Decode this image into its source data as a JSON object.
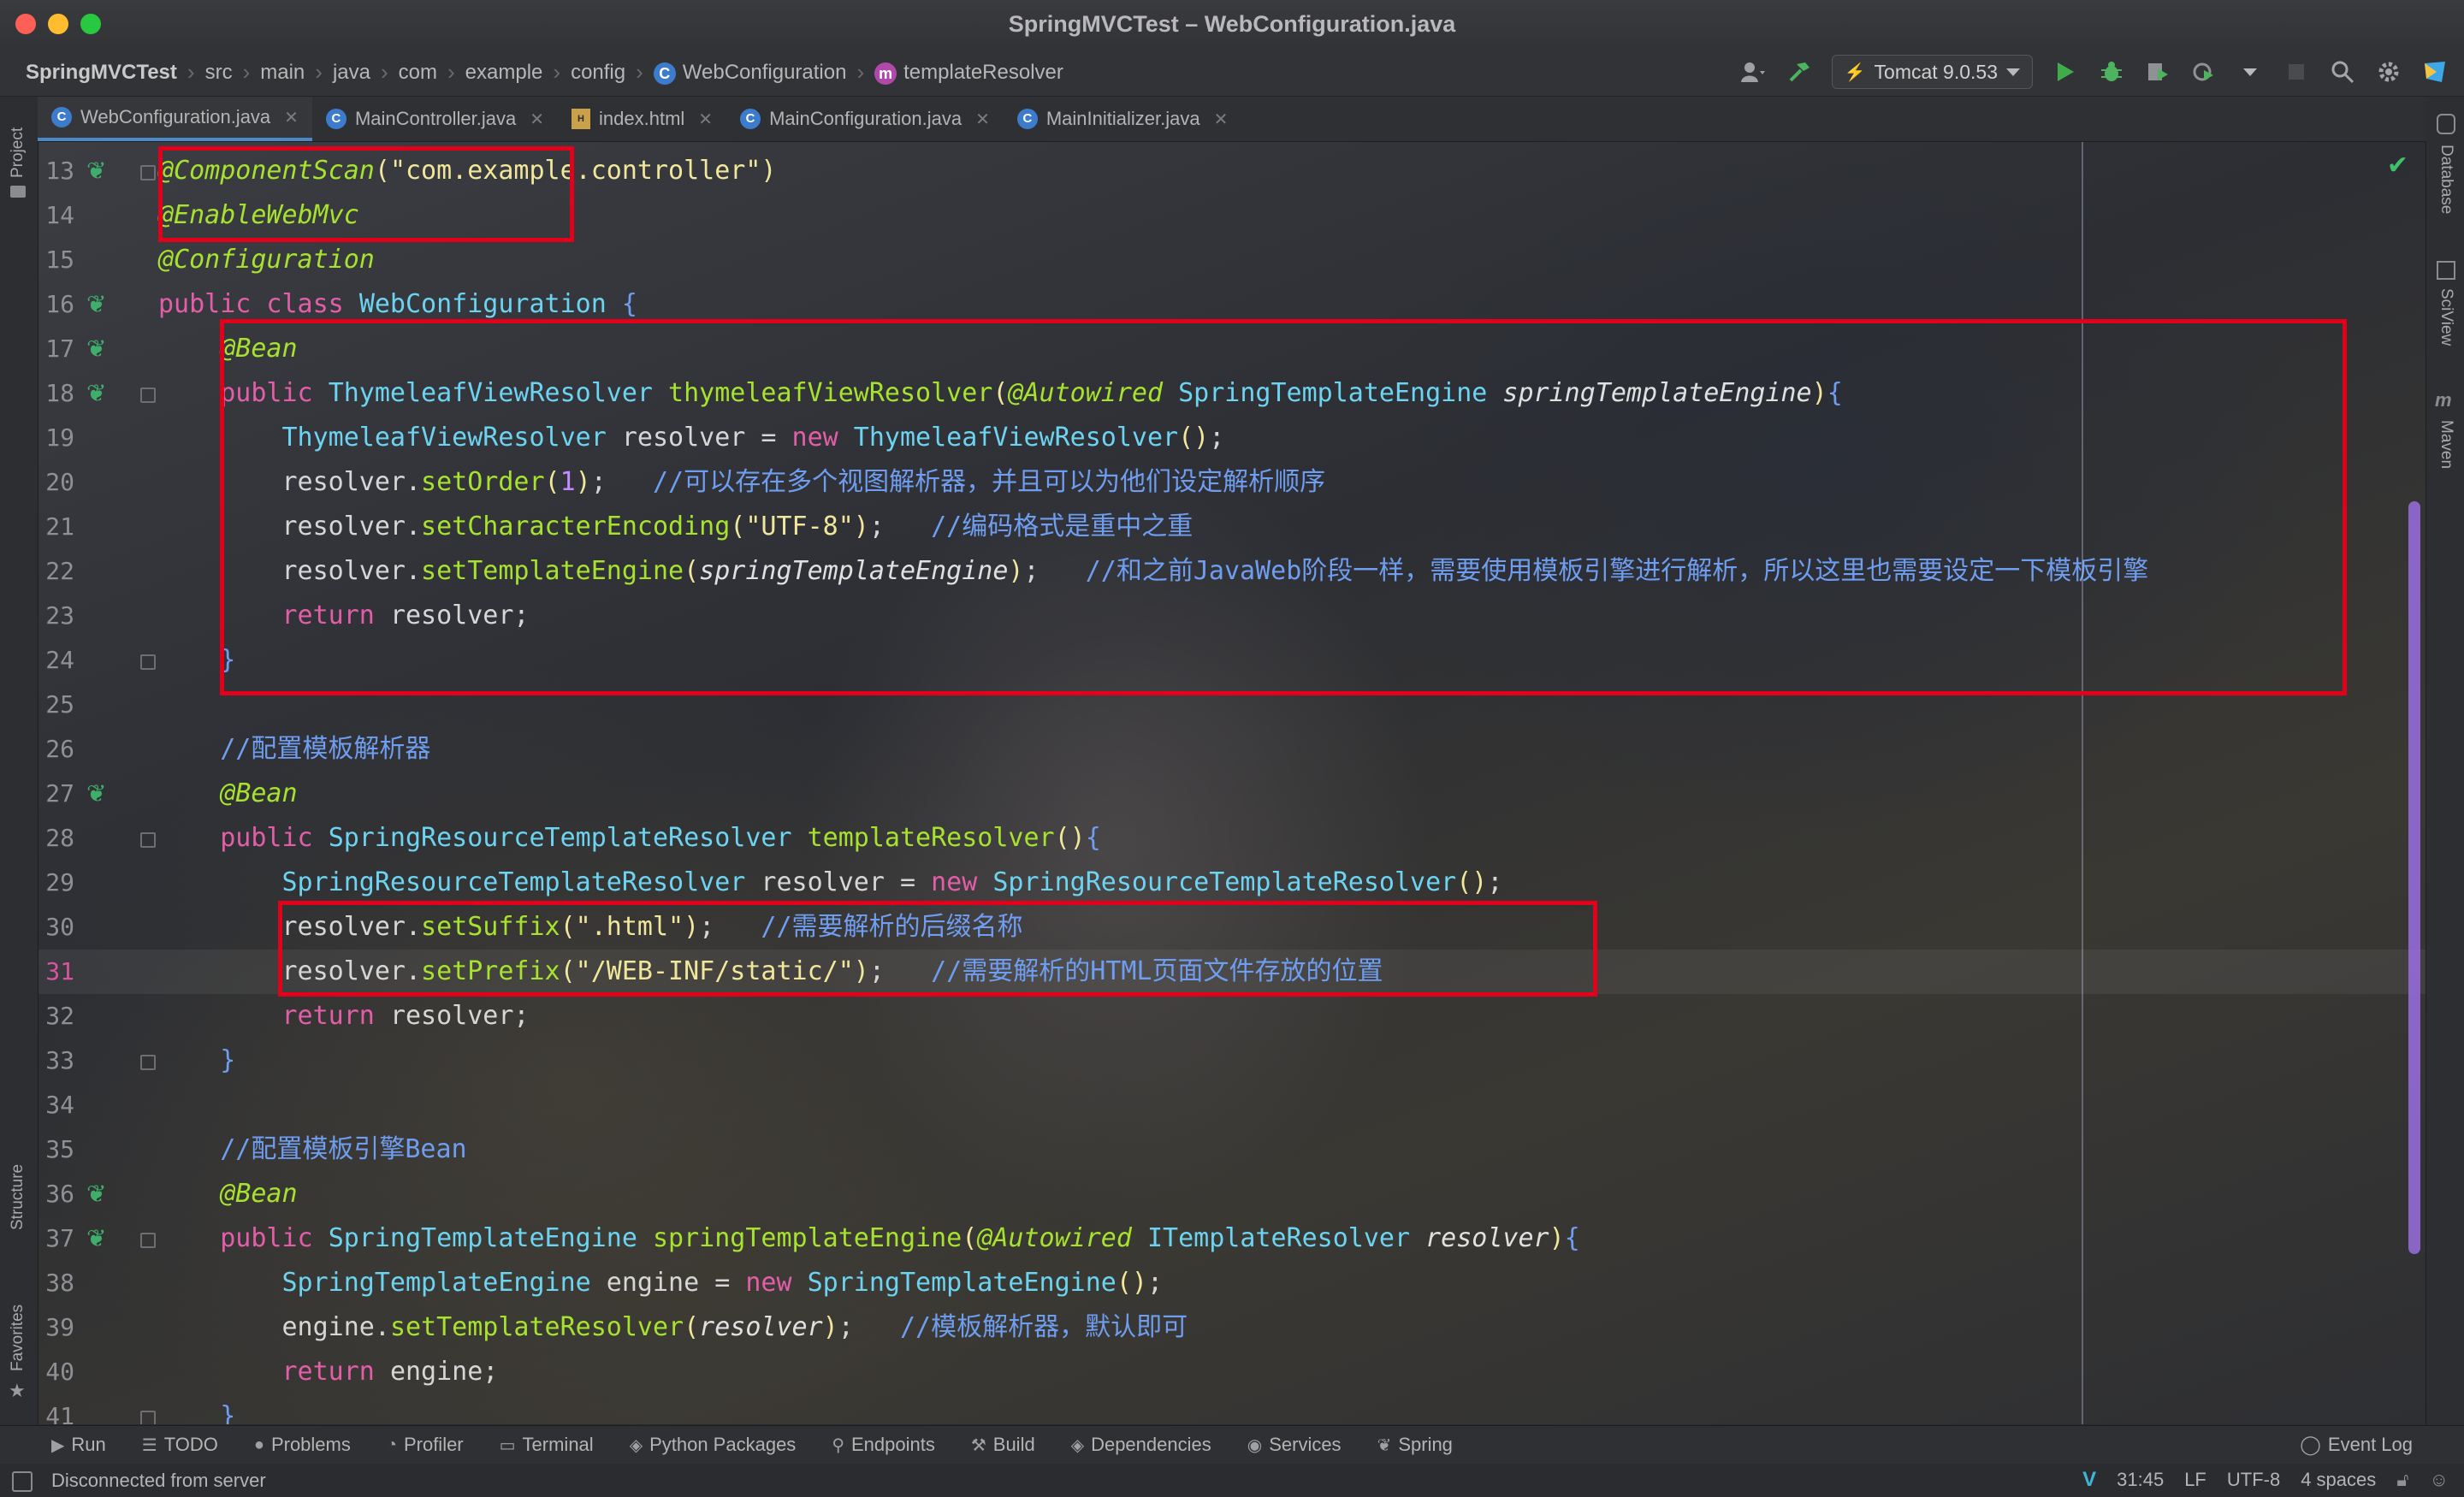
{
  "window": {
    "title": "SpringMVCTest – WebConfiguration.java"
  },
  "breadcrumb": [
    "SpringMVCTest",
    "src",
    "main",
    "java",
    "com",
    "example",
    "config",
    "WebConfiguration",
    "templateResolver"
  ],
  "run_config": {
    "label": "Tomcat 9.0.53"
  },
  "tabs": [
    {
      "label": "WebConfiguration.java",
      "icon": "class-icon",
      "active": true
    },
    {
      "label": "MainController.java",
      "icon": "class-icon",
      "active": false
    },
    {
      "label": "index.html",
      "icon": "html-file-icon",
      "active": false
    },
    {
      "label": "MainConfiguration.java",
      "icon": "class-icon",
      "active": false
    },
    {
      "label": "MainInitializer.java",
      "icon": "class-icon",
      "active": false
    }
  ],
  "left_panels": {
    "project": "Project",
    "structure": "Structure",
    "favorites": "Favorites"
  },
  "right_panels": {
    "database": "Database",
    "sciview": "SciView",
    "maven": "Maven"
  },
  "editor": {
    "current_line": 31,
    "lines": [
      {
        "n": 13,
        "tokens": [
          {
            "t": "@ComponentScan",
            "c": "ann"
          },
          {
            "t": "(",
            "c": "br"
          },
          {
            "t": "\"com.example.controller\"",
            "c": "str"
          },
          {
            "t": ")",
            "c": "br"
          }
        ]
      },
      {
        "n": 14,
        "tokens": [
          {
            "t": "@EnableWebMvc",
            "c": "ann"
          }
        ]
      },
      {
        "n": 15,
        "tokens": [
          {
            "t": "@Configuration",
            "c": "ann"
          }
        ]
      },
      {
        "n": 16,
        "tokens": [
          {
            "t": "public class ",
            "c": "kw"
          },
          {
            "t": "WebConfiguration ",
            "c": "typ"
          },
          {
            "t": "{",
            "c": "cm"
          }
        ]
      },
      {
        "n": 17,
        "tokens": [
          {
            "t": "    "
          },
          {
            "t": "@Bean",
            "c": "ann"
          }
        ]
      },
      {
        "n": 18,
        "tokens": [
          {
            "t": "    "
          },
          {
            "t": "public ",
            "c": "kw"
          },
          {
            "t": "ThymeleafViewResolver ",
            "c": "typ"
          },
          {
            "t": "thymeleafViewResolver",
            "c": "mth"
          },
          {
            "t": "(",
            "c": "br"
          },
          {
            "t": "@Autowired ",
            "c": "ann"
          },
          {
            "t": "SpringTemplateEngine ",
            "c": "typ"
          },
          {
            "t": "springTemplateEngine",
            "c": "prm"
          },
          {
            "t": ")",
            "c": "br"
          },
          {
            "t": "{",
            "c": "cm"
          }
        ]
      },
      {
        "n": 19,
        "tokens": [
          {
            "t": "        "
          },
          {
            "t": "ThymeleafViewResolver ",
            "c": "typ"
          },
          {
            "t": "resolver = "
          },
          {
            "t": "new ",
            "c": "kw"
          },
          {
            "t": "ThymeleafViewResolver",
            "c": "typ"
          },
          {
            "t": "()",
            "c": "br"
          },
          {
            "t": ";"
          }
        ]
      },
      {
        "n": 20,
        "tokens": [
          {
            "t": "        resolver."
          },
          {
            "t": "setOrder",
            "c": "mth"
          },
          {
            "t": "(",
            "c": "br"
          },
          {
            "t": "1",
            "c": "num"
          },
          {
            "t": ")",
            "c": "br"
          },
          {
            "t": ";   "
          },
          {
            "t": "//可以存在多个视图解析器，并且可以为他们设定解析顺序",
            "c": "cm"
          }
        ]
      },
      {
        "n": 21,
        "tokens": [
          {
            "t": "        resolver."
          },
          {
            "t": "setCharacterEncoding",
            "c": "mth"
          },
          {
            "t": "(",
            "c": "br"
          },
          {
            "t": "\"UTF-8\"",
            "c": "str"
          },
          {
            "t": ")",
            "c": "br"
          },
          {
            "t": ";   "
          },
          {
            "t": "//编码格式是重中之重",
            "c": "cm"
          }
        ]
      },
      {
        "n": 22,
        "tokens": [
          {
            "t": "        resolver."
          },
          {
            "t": "setTemplateEngine",
            "c": "mth"
          },
          {
            "t": "(",
            "c": "br"
          },
          {
            "t": "springTemplateEngine",
            "c": "prm"
          },
          {
            "t": ")",
            "c": "br"
          },
          {
            "t": ";   "
          },
          {
            "t": "//和之前JavaWeb阶段一样，需要使用模板引擎进行解析，所以这里也需要设定一下模板引擎",
            "c": "cm"
          }
        ]
      },
      {
        "n": 23,
        "tokens": [
          {
            "t": "        "
          },
          {
            "t": "return ",
            "c": "kw"
          },
          {
            "t": "resolver;"
          }
        ]
      },
      {
        "n": 24,
        "tokens": [
          {
            "t": "    "
          },
          {
            "t": "}",
            "c": "cm"
          }
        ]
      },
      {
        "n": 25,
        "tokens": []
      },
      {
        "n": 26,
        "tokens": [
          {
            "t": "    "
          },
          {
            "t": "//配置模板解析器",
            "c": "cm"
          }
        ]
      },
      {
        "n": 27,
        "tokens": [
          {
            "t": "    "
          },
          {
            "t": "@Bean",
            "c": "ann"
          }
        ]
      },
      {
        "n": 28,
        "tokens": [
          {
            "t": "    "
          },
          {
            "t": "public ",
            "c": "kw"
          },
          {
            "t": "SpringResourceTemplateResolver ",
            "c": "typ"
          },
          {
            "t": "templateResolver",
            "c": "mth"
          },
          {
            "t": "()",
            "c": "br"
          },
          {
            "t": "{",
            "c": "cm"
          }
        ]
      },
      {
        "n": 29,
        "tokens": [
          {
            "t": "        "
          },
          {
            "t": "SpringResourceTemplateResolver ",
            "c": "typ"
          },
          {
            "t": "resolver = "
          },
          {
            "t": "new ",
            "c": "kw"
          },
          {
            "t": "SpringResourceTemplateResolver",
            "c": "typ"
          },
          {
            "t": "()",
            "c": "br"
          },
          {
            "t": ";"
          }
        ]
      },
      {
        "n": 30,
        "tokens": [
          {
            "t": "        resolver."
          },
          {
            "t": "setSuffix",
            "c": "mth"
          },
          {
            "t": "(",
            "c": "br"
          },
          {
            "t": "\".html\"",
            "c": "str"
          },
          {
            "t": ")",
            "c": "br"
          },
          {
            "t": ";   "
          },
          {
            "t": "//需要解析的后缀名称",
            "c": "cm"
          }
        ]
      },
      {
        "n": 31,
        "tokens": [
          {
            "t": "        resolver."
          },
          {
            "t": "setPrefix",
            "c": "mth"
          },
          {
            "t": "(",
            "c": "br"
          },
          {
            "t": "\"/WEB-INF/static/\"",
            "c": "str"
          },
          {
            "t": ")",
            "c": "br"
          },
          {
            "t": ";   "
          },
          {
            "t": "//需要解析的HTML页面文件存放的位置",
            "c": "cm"
          }
        ]
      },
      {
        "n": 32,
        "tokens": [
          {
            "t": "        "
          },
          {
            "t": "return ",
            "c": "kw"
          },
          {
            "t": "resolver;"
          }
        ]
      },
      {
        "n": 33,
        "tokens": [
          {
            "t": "    "
          },
          {
            "t": "}",
            "c": "cm"
          }
        ]
      },
      {
        "n": 34,
        "tokens": []
      },
      {
        "n": 35,
        "tokens": [
          {
            "t": "    "
          },
          {
            "t": "//配置模板引擎Bean",
            "c": "cm"
          }
        ]
      },
      {
        "n": 36,
        "tokens": [
          {
            "t": "    "
          },
          {
            "t": "@Bean",
            "c": "ann"
          }
        ]
      },
      {
        "n": 37,
        "tokens": [
          {
            "t": "    "
          },
          {
            "t": "public ",
            "c": "kw"
          },
          {
            "t": "SpringTemplateEngine ",
            "c": "typ"
          },
          {
            "t": "springTemplateEngine",
            "c": "mth"
          },
          {
            "t": "(",
            "c": "br"
          },
          {
            "t": "@Autowired ",
            "c": "ann"
          },
          {
            "t": "ITemplateResolver ",
            "c": "typ"
          },
          {
            "t": "resolver",
            "c": "prm"
          },
          {
            "t": ")",
            "c": "br"
          },
          {
            "t": "{",
            "c": "cm"
          }
        ]
      },
      {
        "n": 38,
        "tokens": [
          {
            "t": "        "
          },
          {
            "t": "SpringTemplateEngine ",
            "c": "typ"
          },
          {
            "t": "engine = "
          },
          {
            "t": "new ",
            "c": "kw"
          },
          {
            "t": "SpringTemplateEngine",
            "c": "typ"
          },
          {
            "t": "()",
            "c": "br"
          },
          {
            "t": ";"
          }
        ]
      },
      {
        "n": 39,
        "tokens": [
          {
            "t": "        engine."
          },
          {
            "t": "setTemplateResolver",
            "c": "mth"
          },
          {
            "t": "(",
            "c": "br"
          },
          {
            "t": "resolver",
            "c": "prm"
          },
          {
            "t": ")",
            "c": "br"
          },
          {
            "t": ";   "
          },
          {
            "t": "//模板解析器，默认即可",
            "c": "cm"
          }
        ]
      },
      {
        "n": 40,
        "tokens": [
          {
            "t": "        "
          },
          {
            "t": "return ",
            "c": "kw"
          },
          {
            "t": "engine;"
          }
        ]
      },
      {
        "n": 41,
        "tokens": [
          {
            "t": "    "
          },
          {
            "t": "}",
            "c": "cm"
          }
        ]
      }
    ]
  },
  "tool_windows": [
    {
      "label": "Run",
      "icon": "play-icon"
    },
    {
      "label": "TODO",
      "icon": "list-icon"
    },
    {
      "label": "Problems",
      "icon": "warning-icon"
    },
    {
      "label": "Profiler",
      "icon": "profiler-icon"
    },
    {
      "label": "Terminal",
      "icon": "terminal-icon"
    },
    {
      "label": "Python Packages",
      "icon": "layers-icon"
    },
    {
      "label": "Endpoints",
      "icon": "endpoints-icon"
    },
    {
      "label": "Build",
      "icon": "hammer-icon"
    },
    {
      "label": "Dependencies",
      "icon": "layers-icon"
    },
    {
      "label": "Services",
      "icon": "services-icon"
    },
    {
      "label": "Spring",
      "icon": "leaf-icon"
    }
  ],
  "event_log": "Event Log",
  "status": {
    "message": "Disconnected from server",
    "caret": "31:45",
    "line_sep": "LF",
    "encoding": "UTF-8",
    "indent": "4 spaces"
  },
  "colors": {
    "keyword": "#e35ea8",
    "annotation": "#a6e22e",
    "type": "#6cd3f0",
    "method": "#a6e22e",
    "string": "#f1e79b",
    "number": "#c48cff",
    "comment": "#6f9df0",
    "highlight_box": "#e3001b"
  }
}
